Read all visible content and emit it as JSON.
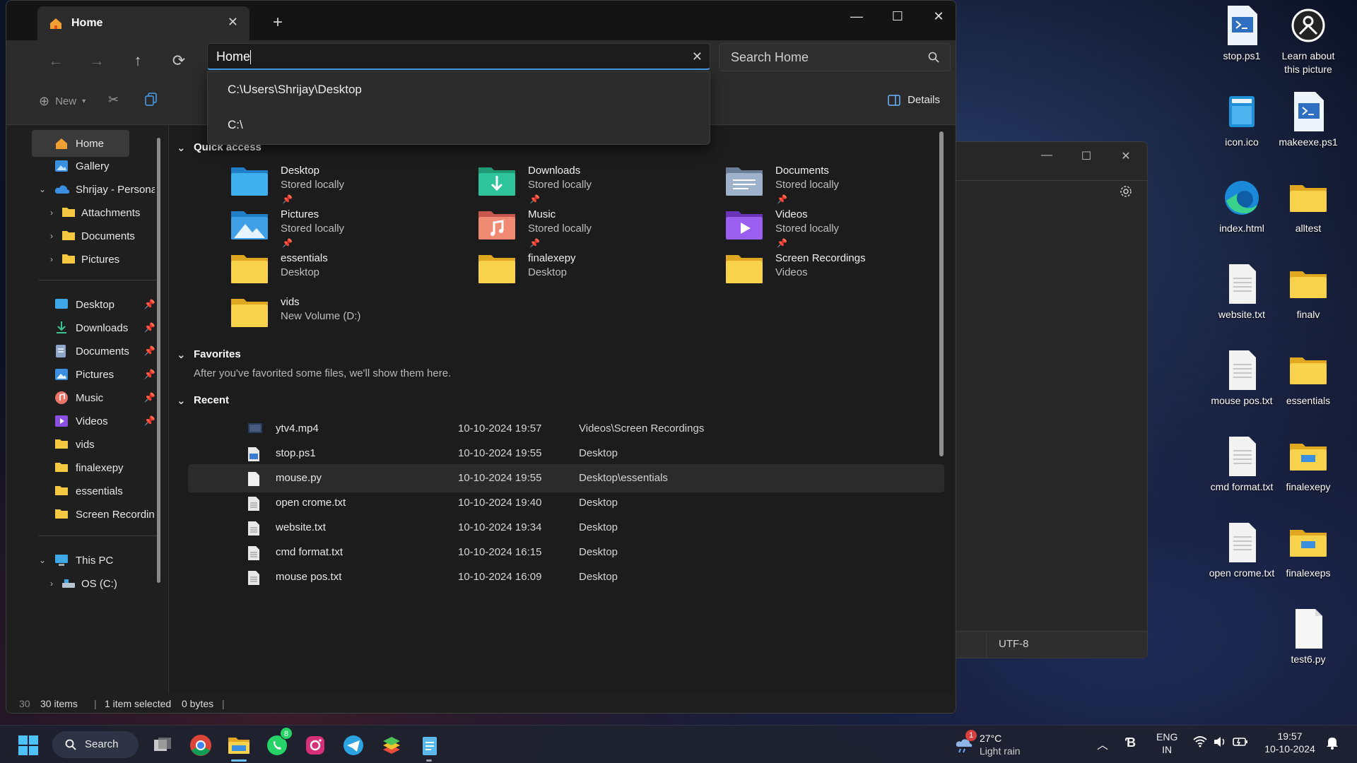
{
  "explorer": {
    "tab_title": "Home",
    "address_value": "Home",
    "search_placeholder": "Search Home",
    "address_suggestions": [
      "C:\\Users\\Shrijay\\Desktop",
      "C:\\"
    ],
    "toolbar": {
      "new_label": "New",
      "details_label": "Details"
    },
    "sidebar": {
      "home": "Home",
      "gallery": "Gallery",
      "onedrive": "Shrijay - Persona",
      "od_children": [
        "Attachments",
        "Documents",
        "Pictures"
      ],
      "pinned": [
        {
          "label": "Desktop",
          "icon": "desktop-icon"
        },
        {
          "label": "Downloads",
          "icon": "download-icon"
        },
        {
          "label": "Documents",
          "icon": "documents-icon"
        },
        {
          "label": "Pictures",
          "icon": "pictures-icon"
        },
        {
          "label": "Music",
          "icon": "music-icon"
        },
        {
          "label": "Videos",
          "icon": "videos-icon"
        }
      ],
      "folders": [
        "vids",
        "finalexepy",
        "essentials",
        "Screen Recordin"
      ],
      "this_pc": "This PC",
      "drive_c": "OS (C:)"
    },
    "quick_access": {
      "title": "Quick access",
      "items": [
        {
          "name": "Desktop",
          "sub": "Stored locally",
          "pinned": true
        },
        {
          "name": "Downloads",
          "sub": "Stored locally",
          "pinned": true
        },
        {
          "name": "Documents",
          "sub": "Stored locally",
          "pinned": true
        },
        {
          "name": "Pictures",
          "sub": "Stored locally",
          "pinned": true
        },
        {
          "name": "Music",
          "sub": "Stored locally",
          "pinned": true
        },
        {
          "name": "Videos",
          "sub": "Stored locally",
          "pinned": true
        },
        {
          "name": "essentials",
          "sub": "Desktop",
          "pinned": false
        },
        {
          "name": "finalexepy",
          "sub": "Desktop",
          "pinned": false
        },
        {
          "name": "Screen Recordings",
          "sub": "Videos",
          "pinned": false
        },
        {
          "name": "vids",
          "sub": "New Volume (D:)",
          "pinned": false
        }
      ]
    },
    "favorites": {
      "title": "Favorites",
      "empty_text": "After you've favorited some files, we'll show them here."
    },
    "recent": {
      "title": "Recent",
      "rows": [
        {
          "name": "ytv4.mp4",
          "date": "10-10-2024 19:57",
          "location": "Videos\\Screen Recordings",
          "icon": "video-file-icon"
        },
        {
          "name": "stop.ps1",
          "date": "10-10-2024 19:55",
          "location": "Desktop",
          "icon": "powershell-file-icon"
        },
        {
          "name": "mouse.py",
          "date": "10-10-2024 19:55",
          "location": "Desktop\\essentials",
          "icon": "file-icon"
        },
        {
          "name": "open crome.txt",
          "date": "10-10-2024 19:40",
          "location": "Desktop",
          "icon": "text-file-icon"
        },
        {
          "name": "website.txt",
          "date": "10-10-2024 19:34",
          "location": "Desktop",
          "icon": "text-file-icon"
        },
        {
          "name": "cmd format.txt",
          "date": "10-10-2024 16:15",
          "location": "Desktop",
          "icon": "text-file-icon"
        },
        {
          "name": "mouse pos.txt",
          "date": "10-10-2024 16:09",
          "location": "Desktop",
          "icon": "text-file-icon"
        }
      ],
      "selected_index": 2
    },
    "status": {
      "leading_count": "30",
      "items": "30 items",
      "selected": "1 item selected",
      "size": "0 bytes"
    }
  },
  "notepad_bg": {
    "encoding": "UTF-8"
  },
  "desktop_icons": [
    {
      "label": "stop.ps1",
      "icon": "powershell-file-icon"
    },
    {
      "label": "Learn about this picture",
      "icon": "learn-picture-icon"
    },
    {
      "label": "icon.ico",
      "icon": "ico-file-icon"
    },
    {
      "label": "makeexe.ps1",
      "icon": "powershell-file-icon"
    },
    {
      "label": "index.html",
      "icon": "edge-icon"
    },
    {
      "label": "alltest",
      "icon": "folder-icon"
    },
    {
      "label": "website.txt",
      "icon": "text-file-icon"
    },
    {
      "label": "finalv",
      "icon": "folder-icon"
    },
    {
      "label": "mouse pos.txt",
      "icon": "text-file-icon"
    },
    {
      "label": "essentials",
      "icon": "folder-icon"
    },
    {
      "label": "cmd format.txt",
      "icon": "text-file-icon"
    },
    {
      "label": "finalexepy",
      "icon": "folder-icon"
    },
    {
      "label": "open crome.txt",
      "icon": "text-file-icon"
    },
    {
      "label": "finalexeps",
      "icon": "folder-icon"
    },
    {
      "label": "test6.py",
      "icon": "file-icon"
    }
  ],
  "taskbar": {
    "search_label": "Search",
    "whatsapp_badge": "8",
    "weather_badge": "1",
    "weather_temp": "27°C",
    "weather_desc": "Light rain",
    "lang_line1": "ENG",
    "lang_line2": "IN",
    "time": "19:57",
    "date": "10-10-2024"
  },
  "colors": {
    "accent": "#4aa0f0",
    "folder": "#f5c842",
    "selected_row": "#2b2b2b"
  }
}
